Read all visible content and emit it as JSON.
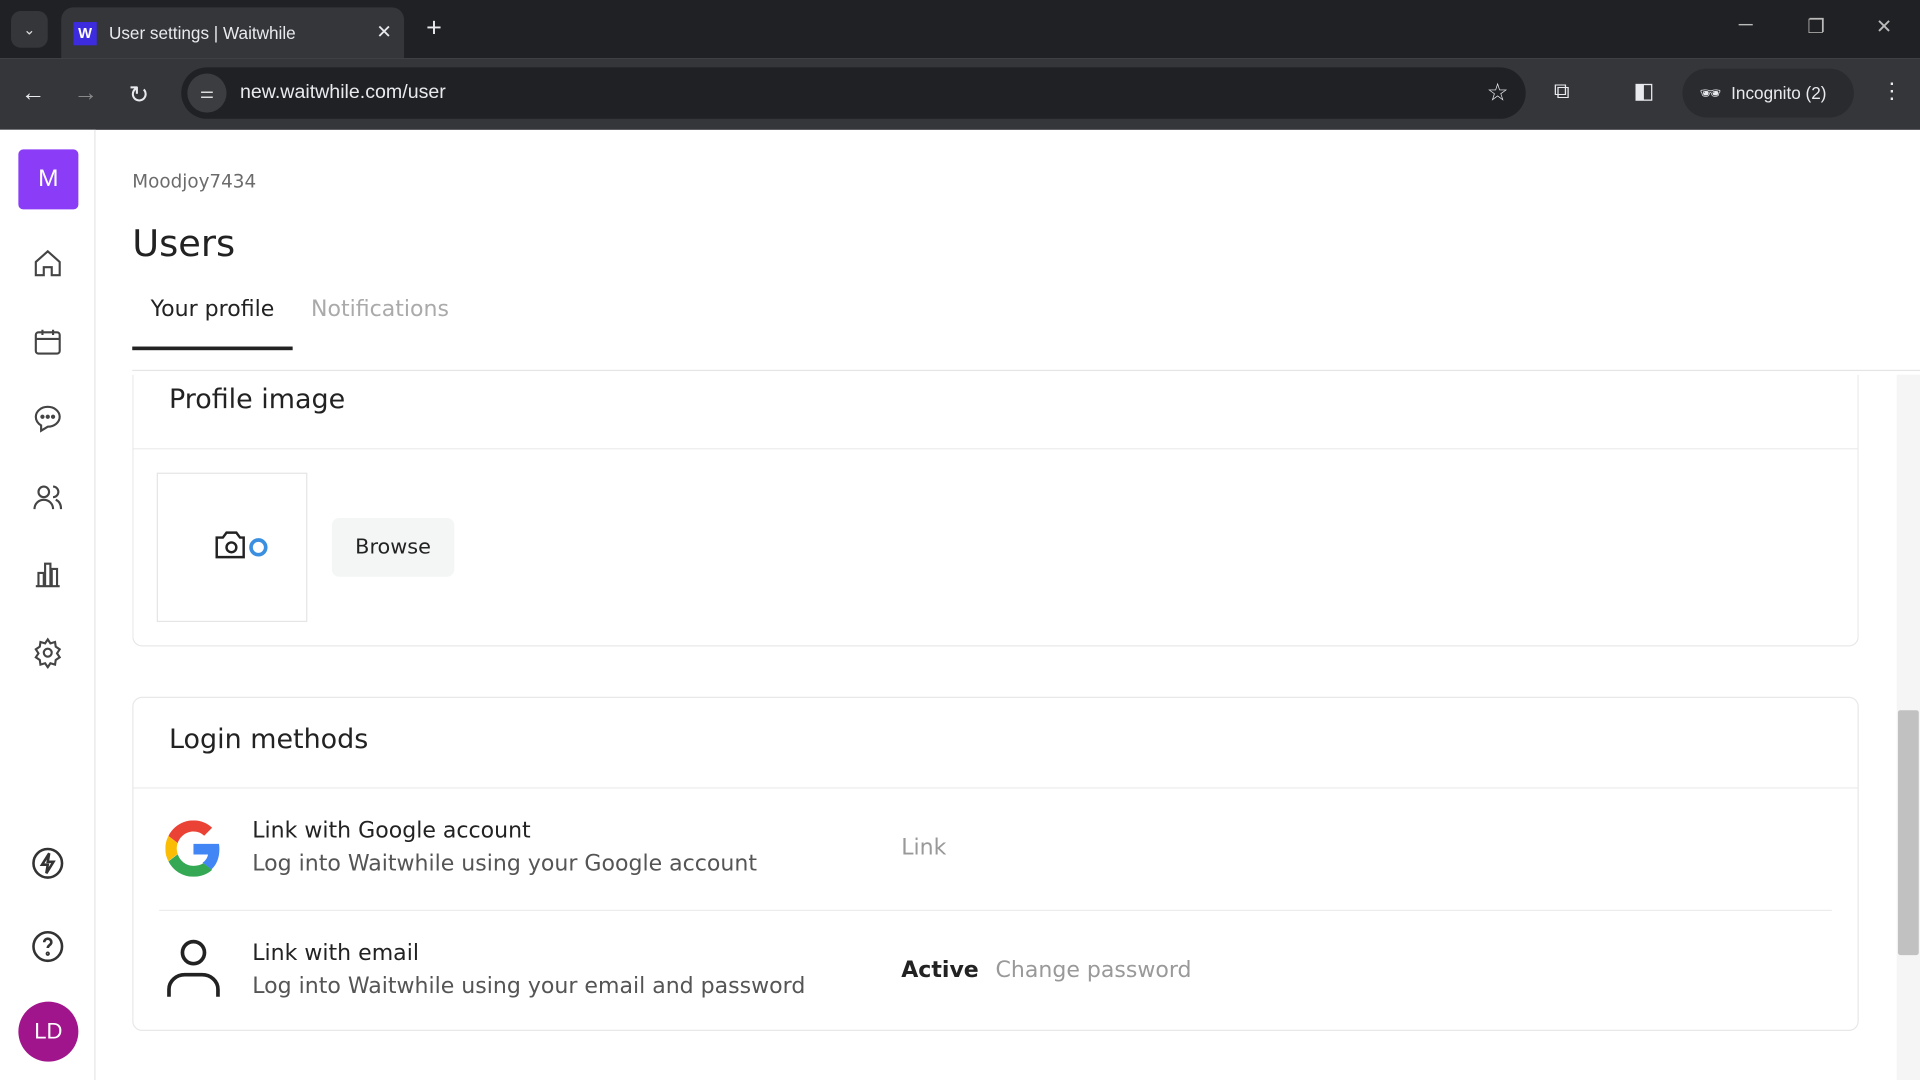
{
  "browser": {
    "tab_title": "User settings | Waitwhile",
    "favicon": "W",
    "url": "new.waitwhile.com/user",
    "incognito": "Incognito (2)"
  },
  "sidebar": {
    "logo": "M",
    "avatar": "LD",
    "items": [
      "home-icon",
      "calendar-icon",
      "chat-icon",
      "users-icon",
      "chart-icon",
      "gear-icon",
      "bolt-icon",
      "help-icon"
    ]
  },
  "header": {
    "org": "Moodjoy7434",
    "title": "Users",
    "tabs": [
      {
        "label": "Your profile",
        "active": true
      },
      {
        "label": "Notifications",
        "active": false
      }
    ]
  },
  "profile_image": {
    "title": "Profile image",
    "browse": "Browse"
  },
  "login": {
    "title": "Login methods",
    "methods": [
      {
        "title": "Link with Google account",
        "subtitle": "Log into Waitwhile using your Google account",
        "action": "Link"
      },
      {
        "title": "Link with email",
        "subtitle": "Log into Waitwhile using your email and password",
        "status": "Active",
        "action": "Change password"
      }
    ]
  },
  "colors": {
    "brand": "#8b3cf7",
    "avatar": "#a0148c"
  }
}
